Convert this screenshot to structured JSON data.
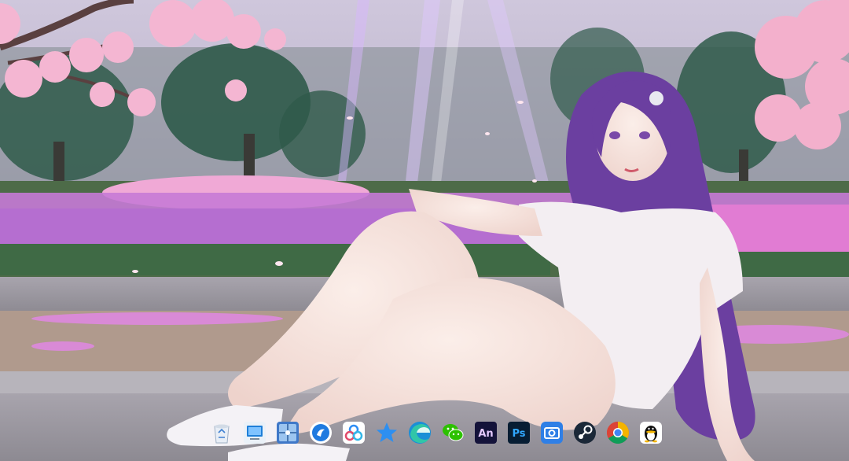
{
  "wallpaper": {
    "name": "anime-girl-cherry-blossom-park",
    "colors": {
      "sky": "#d9d2e6",
      "hair": "#6b3fa0",
      "flowers": "#d98ad6",
      "blossom": "#f4b6d2",
      "road": "#a9a6ad",
      "tree": "#2f5a4a"
    }
  },
  "dock": {
    "items": [
      {
        "name": "recycle-bin",
        "icon": "recycle-bin-icon"
      },
      {
        "name": "this-pc",
        "icon": "computer-icon"
      },
      {
        "name": "control-panel",
        "icon": "control-panel-icon"
      },
      {
        "name": "blue-circle-app",
        "icon": "blue-circle-icon"
      },
      {
        "name": "baidu-netdisk",
        "icon": "cloud-rings-icon"
      },
      {
        "name": "favorites",
        "icon": "star-icon"
      },
      {
        "name": "microsoft-edge",
        "icon": "edge-icon"
      },
      {
        "name": "wechat",
        "icon": "wechat-icon"
      },
      {
        "name": "adobe-animate",
        "icon": "animate-icon",
        "text": "An"
      },
      {
        "name": "adobe-photoshop",
        "icon": "photoshop-icon",
        "text": "Ps"
      },
      {
        "name": "screenshot-tool",
        "icon": "camera-icon"
      },
      {
        "name": "steam",
        "icon": "steam-icon"
      },
      {
        "name": "google-chrome",
        "icon": "chrome-icon"
      },
      {
        "name": "qq",
        "icon": "qq-penguin-icon"
      }
    ]
  }
}
